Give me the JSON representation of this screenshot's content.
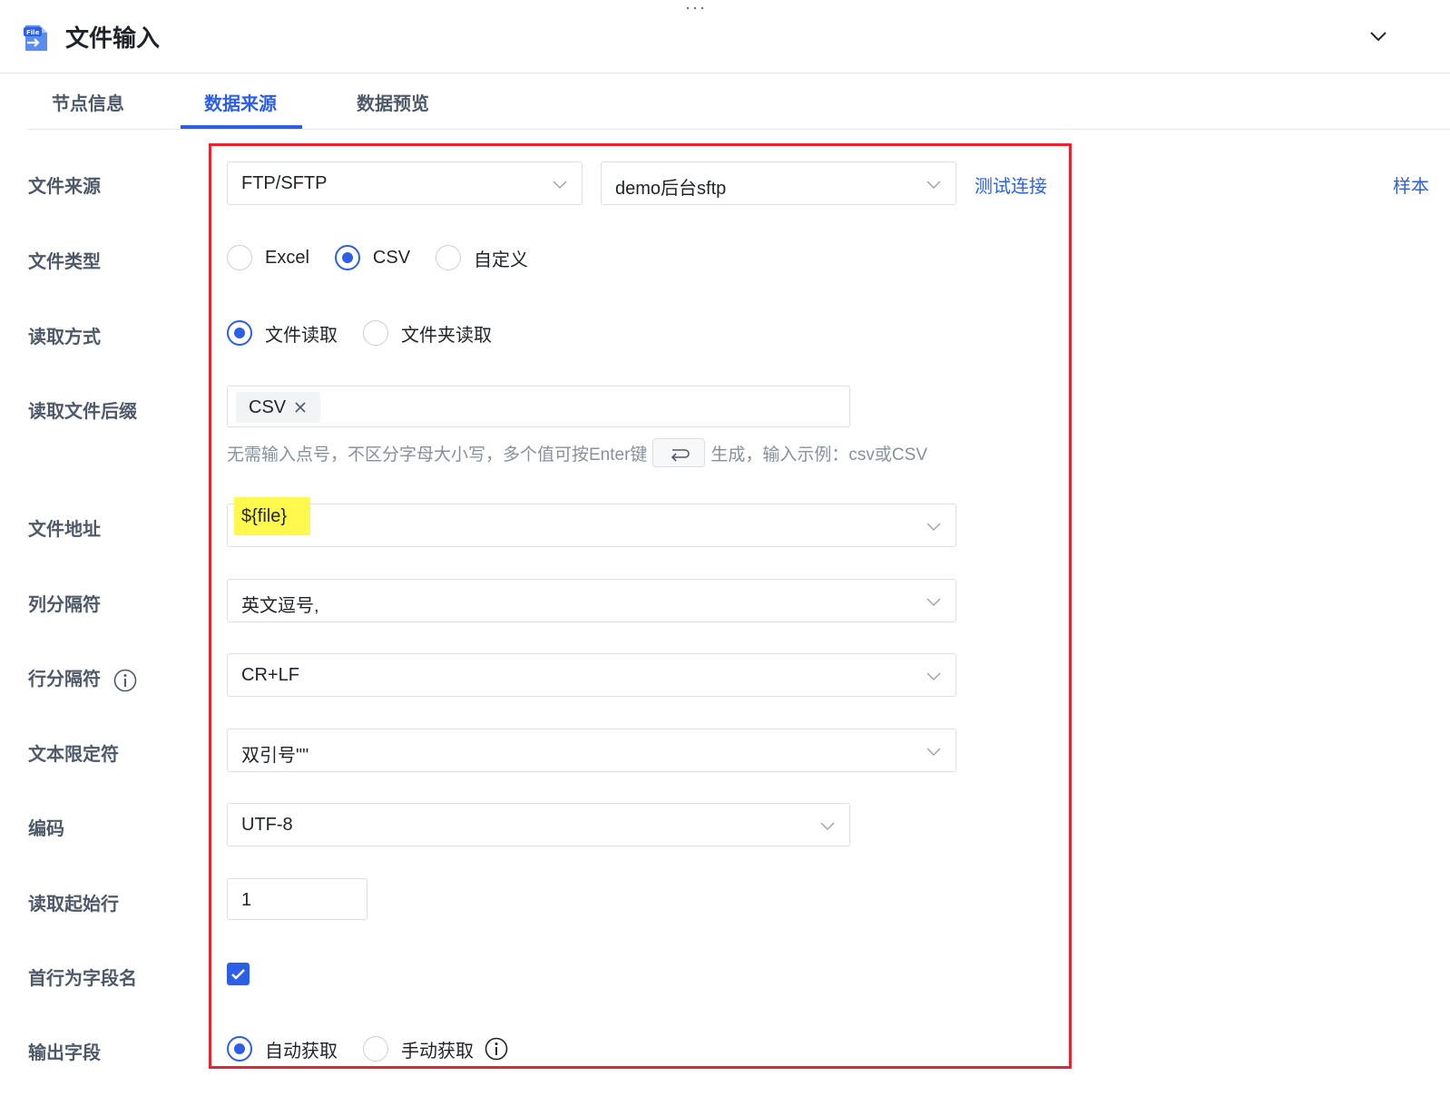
{
  "header": {
    "title": "文件输入",
    "icon": "file-input-icon",
    "icon_badge": "File"
  },
  "tabs": [
    {
      "label": "节点信息",
      "active": false
    },
    {
      "label": "数据来源",
      "active": true
    },
    {
      "label": "数据预览",
      "active": false
    }
  ],
  "accent_color": "#2c5ee8",
  "highlight_color": "#e8222e",
  "form": {
    "file_source": {
      "label": "文件来源",
      "type_value": "FTP/SFTP",
      "connection_value": "demo后台sftp",
      "test_link": "测试连接",
      "sample_link": "样本"
    },
    "file_type": {
      "label": "文件类型",
      "options": [
        "Excel",
        "CSV",
        "自定义"
      ],
      "selected": "CSV"
    },
    "read_mode": {
      "label": "读取方式",
      "options": [
        "文件读取",
        "文件夹读取"
      ],
      "selected": "文件读取"
    },
    "suffix": {
      "label": "读取文件后缀",
      "tag": "CSV",
      "hint_before": "无需输入点号，不区分字母大小写，多个值可按Enter键",
      "hint_after": "生成，输入示例：csv或CSV"
    },
    "file_path": {
      "label": "文件地址",
      "value": "${file}"
    },
    "col_sep": {
      "label": "列分隔符",
      "value": "英文逗号,"
    },
    "row_sep": {
      "label": "行分隔符",
      "value": "CR+LF"
    },
    "text_qualifier": {
      "label": "文本限定符",
      "value": "双引号\"\""
    },
    "encoding": {
      "label": "编码",
      "value": "UTF-8"
    },
    "start_row": {
      "label": "读取起始行",
      "value": "1"
    },
    "header_row": {
      "label": "首行为字段名",
      "checked": true
    },
    "output_fields": {
      "label": "输出字段",
      "options": [
        "自动获取",
        "手动获取"
      ],
      "selected": "自动获取"
    }
  }
}
